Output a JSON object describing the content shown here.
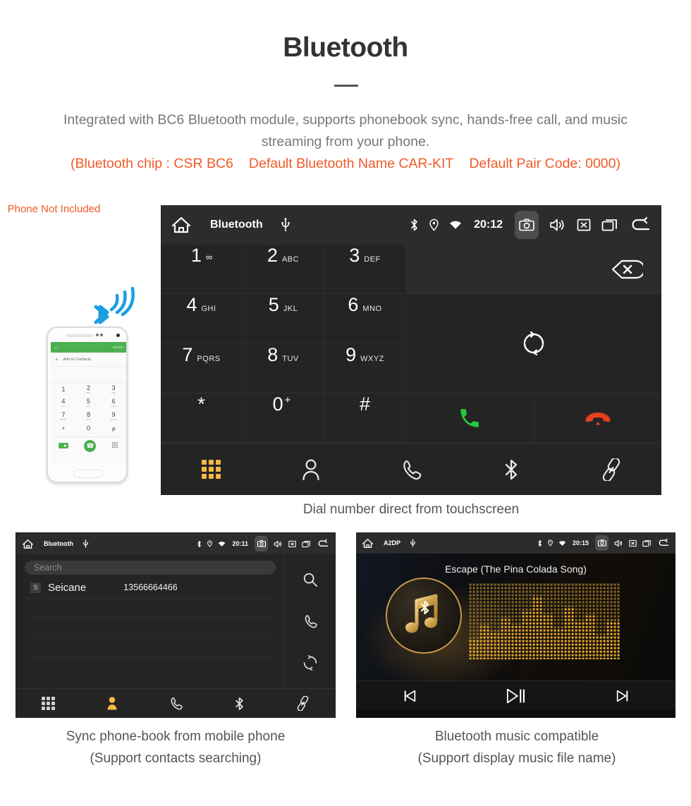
{
  "header": {
    "title": "Bluetooth",
    "subtitle": "Integrated with BC6 Bluetooth module, supports phonebook sync, hands-free call, and music streaming from your phone.",
    "spec_chip": "(Bluetooth chip : CSR BC6",
    "spec_name": "Default Bluetooth Name CAR-KIT",
    "spec_pair": "Default Pair Code: 0000)"
  },
  "colors": {
    "accent_orange": "#f05a28",
    "active_tab": "#f5b841",
    "call_green": "#22c93f",
    "end_red": "#e8401f",
    "panel_bg": "#1b1b1b",
    "key_bg": "#242424",
    "statusbar_bg": "#2c2c2c"
  },
  "phone_mockup": {
    "header_back": "←",
    "header_more": "MORE",
    "add_plus": "+",
    "add_label": "Add to Contacts",
    "keys": [
      {
        "num": "1",
        "sub": ""
      },
      {
        "num": "2",
        "sub": "ABC"
      },
      {
        "num": "3",
        "sub": "DEF"
      },
      {
        "num": "4",
        "sub": "GHI"
      },
      {
        "num": "5",
        "sub": "JKL"
      },
      {
        "num": "6",
        "sub": "MNO"
      },
      {
        "num": "7",
        "sub": "PQRS"
      },
      {
        "num": "8",
        "sub": "TUV"
      },
      {
        "num": "9",
        "sub": "WXYZ"
      },
      {
        "num": "*",
        "sub": ""
      },
      {
        "num": "0",
        "sub": "+"
      },
      {
        "num": "#",
        "sub": ""
      }
    ],
    "caption": "Phone Not Included"
  },
  "dialer_panel": {
    "statusbar": {
      "home_icon": "home-icon",
      "title": "Bluetooth",
      "usb_icon": "usb-icon",
      "bluetooth_icon": "bluetooth-icon",
      "location_icon": "location-icon",
      "wifi_icon": "wifi-icon",
      "time": "20:12",
      "screenshot_icon": "camera-icon",
      "volume_icon": "volume-icon",
      "mute_icon": "mute-box-icon",
      "recents_icon": "recent-apps-icon",
      "back_icon": "back-arrow-icon"
    },
    "keys": [
      {
        "num": "1",
        "sub": "",
        "voicemail": "∞"
      },
      {
        "num": "2",
        "sub": "ABC"
      },
      {
        "num": "3",
        "sub": "DEF"
      },
      {
        "num": "4",
        "sub": "GHI"
      },
      {
        "num": "5",
        "sub": "JKL"
      },
      {
        "num": "6",
        "sub": "MNO"
      },
      {
        "num": "7",
        "sub": "PQRS"
      },
      {
        "num": "8",
        "sub": "TUV"
      },
      {
        "num": "9",
        "sub": "WXYZ"
      },
      {
        "num": "*",
        "sub": ""
      },
      {
        "num": "0",
        "sup": "+"
      },
      {
        "num": "#",
        "sub": ""
      }
    ],
    "number_display": "",
    "backspace_icon": "backspace-icon",
    "sync_icon": "sync-icon",
    "call_icon": "call-icon",
    "hangup_icon": "hangup-icon",
    "tabs": [
      {
        "name": "keypad",
        "icon": "keypad-grid-icon",
        "active": true
      },
      {
        "name": "contacts",
        "icon": "contact-person-icon",
        "active": false
      },
      {
        "name": "call-log",
        "icon": "phone-handset-icon",
        "active": false
      },
      {
        "name": "bluetooth",
        "icon": "bluetooth-icon",
        "active": false
      },
      {
        "name": "pair",
        "icon": "link-chain-icon",
        "active": false
      }
    ],
    "caption": "Dial number direct from touchscreen"
  },
  "phonebook_panel": {
    "statusbar": {
      "title": "Bluetooth",
      "time": "20:11"
    },
    "search_placeholder": "Search",
    "contacts": [
      {
        "initial": "S",
        "name": "Seicane",
        "number": "13566664466"
      }
    ],
    "side_actions": [
      {
        "name": "search",
        "icon": "search-icon"
      },
      {
        "name": "call",
        "icon": "phone-handset-icon"
      },
      {
        "name": "sync",
        "icon": "sync-icon"
      }
    ],
    "tabs": [
      {
        "name": "keypad",
        "icon": "keypad-grid-icon",
        "active": false
      },
      {
        "name": "contacts",
        "icon": "contact-person-icon",
        "active": true
      },
      {
        "name": "call-log",
        "icon": "phone-handset-icon",
        "active": false
      },
      {
        "name": "bluetooth",
        "icon": "bluetooth-icon",
        "active": false
      },
      {
        "name": "pair",
        "icon": "link-chain-icon",
        "active": false
      }
    ],
    "caption_line1": "Sync phone-book from mobile phone",
    "caption_line2": "(Support contacts searching)"
  },
  "music_panel": {
    "statusbar": {
      "title": "A2DP",
      "time": "20:15"
    },
    "song_title": "Escape (The Pina Colada Song)",
    "album_icon": "music-note-bluetooth-icon",
    "visualizer": "dot-matrix-spectrum",
    "controls": [
      {
        "name": "previous",
        "icon": "skip-previous-icon"
      },
      {
        "name": "play-pause",
        "icon": "play-pause-icon"
      },
      {
        "name": "next",
        "icon": "skip-next-icon"
      }
    ],
    "caption_line1": "Bluetooth music compatible",
    "caption_line2": "(Support display music file name)"
  }
}
